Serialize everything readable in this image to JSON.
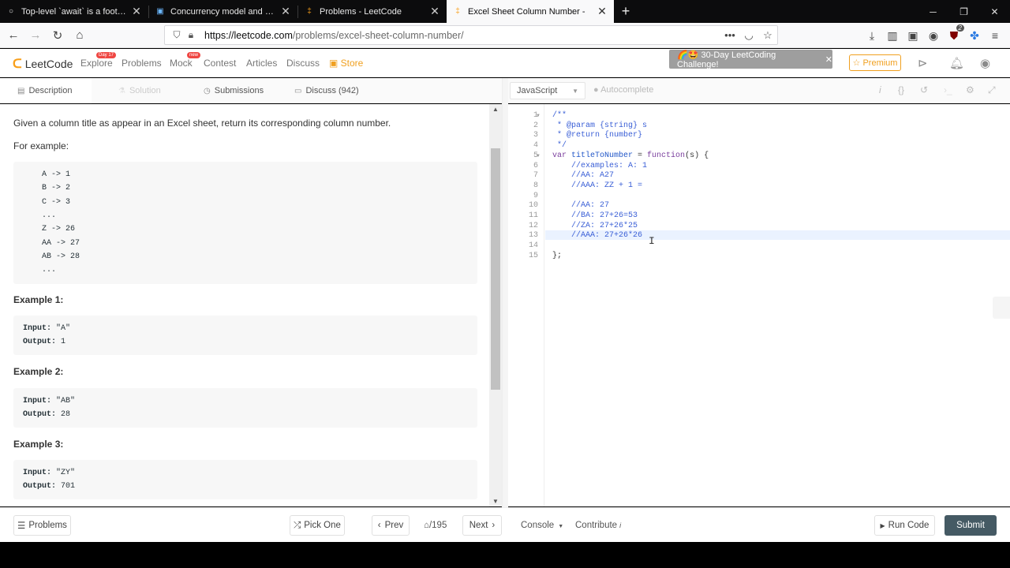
{
  "browser": {
    "tabs": [
      {
        "title": "Top-level `await` is a footgun",
        "icon": "○",
        "active": false
      },
      {
        "title": "Concurrency model and the ev",
        "icon": "▣",
        "active": false
      },
      {
        "title": "Problems - LeetCode",
        "icon": "‡",
        "active": false
      },
      {
        "title": "Excel Sheet Column Number -",
        "icon": "‡",
        "active": true
      }
    ],
    "url_host": "https://leetcode.com",
    "url_path": "/problems/excel-sheet-column-number/",
    "ublock_count": "2"
  },
  "header": {
    "logo": "LeetCode",
    "nav": [
      {
        "label": "Explore",
        "badge": "Day 17"
      },
      {
        "label": "Problems",
        "badge": ""
      },
      {
        "label": "Mock",
        "badge": "new"
      },
      {
        "label": "Contest",
        "badge": ""
      },
      {
        "label": "Articles",
        "badge": ""
      },
      {
        "label": "Discuss",
        "badge": ""
      }
    ],
    "store": "Store",
    "challenge": "🌈🤩 30-Day LeetCoding Challenge!",
    "premium": "☆ Premium"
  },
  "left_tabs": {
    "description": "Description",
    "solution": "Solution",
    "submissions": "Submissions",
    "discuss": "Discuss (942)"
  },
  "problem": {
    "intro": "Given a column title as appear in an Excel sheet, return its corresponding column number.",
    "for_example": "For example:",
    "mapping": [
      "A -> 1",
      "B -> 2",
      "C -> 3",
      "...",
      "Z -> 26",
      "AA -> 27",
      "AB -> 28",
      "..."
    ],
    "examples": [
      {
        "heading": "Example 1:",
        "input": "\"A\"",
        "output": "1"
      },
      {
        "heading": "Example 2:",
        "input": "\"AB\"",
        "output": "28"
      },
      {
        "heading": "Example 3:",
        "input": "\"ZY\"",
        "output": "701"
      }
    ],
    "input_label": "Input:",
    "output_label": "Output:"
  },
  "editor": {
    "language": "JavaScript",
    "autocomplete": "Autocomplete",
    "lines": [
      "/**",
      " * @param {string} s",
      " * @return {number}",
      " */",
      "var titleToNumber = function(s) {",
      "    //examples: A: 1",
      "    //AA: A27",
      "    //AAA: ZZ + 1 =",
      "",
      "    //AA: 27",
      "    //BA: 27+26=53",
      "    //ZA: 27+26*25",
      "    //AAA: 27+26*26",
      "",
      "};"
    ]
  },
  "footer": {
    "problems": "Problems",
    "pick_one": "Pick One",
    "prev": "Prev",
    "page": "/195",
    "next": "Next",
    "console": "Console",
    "contribute": "Contribute",
    "run_code": "Run Code",
    "submit": "Submit"
  }
}
